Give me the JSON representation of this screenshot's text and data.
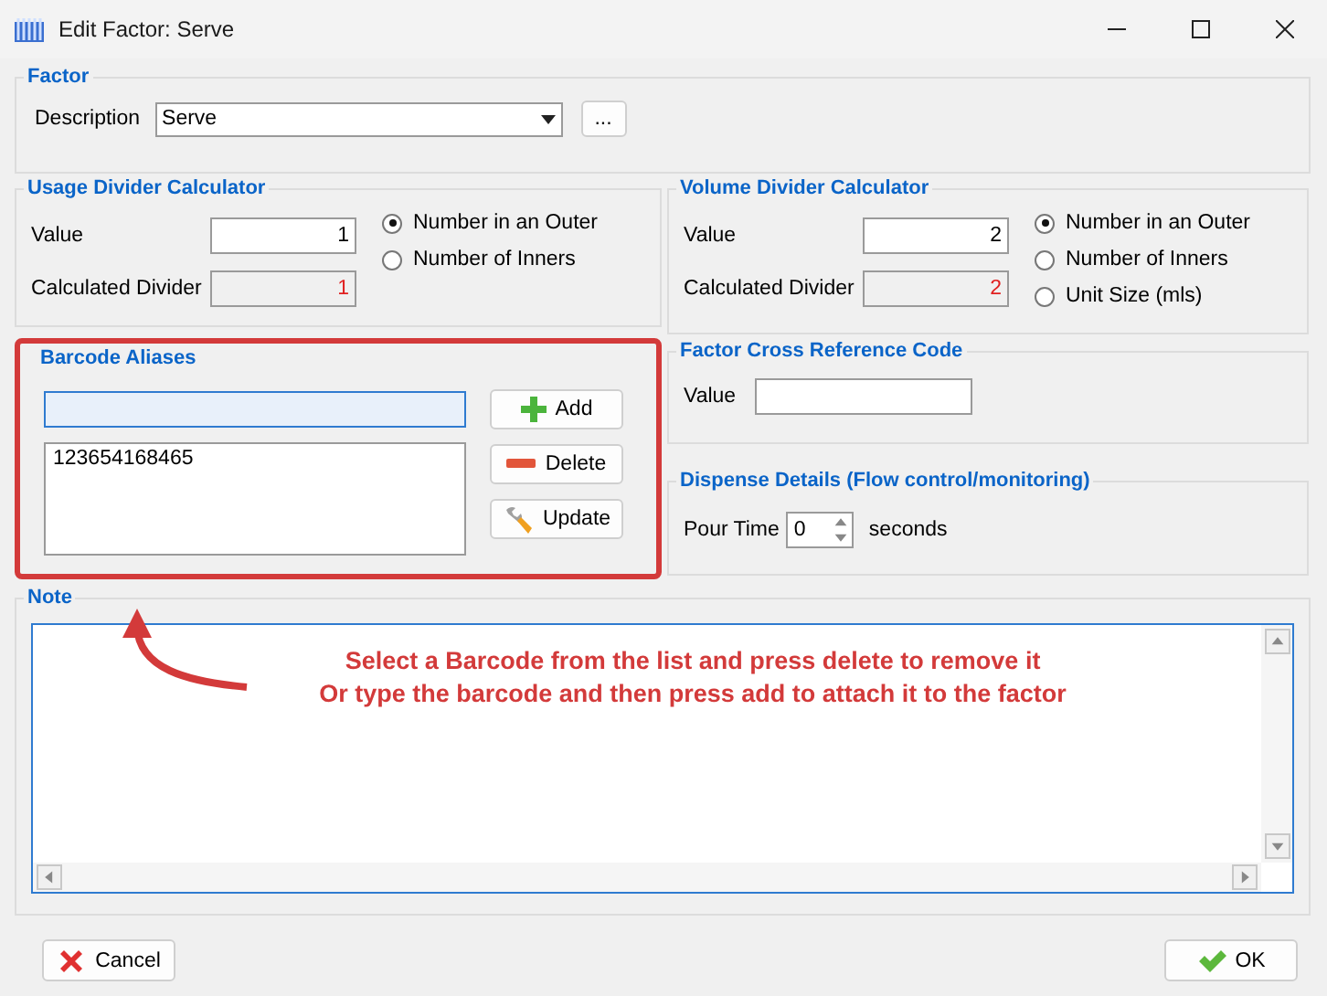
{
  "window": {
    "title": "Edit Factor: Serve"
  },
  "factor": {
    "title": "Factor",
    "description_label": "Description",
    "description_value": "Serve",
    "more_button": "..."
  },
  "usage": {
    "title": "Usage Divider Calculator",
    "value_label": "Value",
    "value": "1",
    "calc_label": "Calculated Divider",
    "calc_value": "1",
    "options": [
      {
        "label": "Number in an Outer",
        "selected": true
      },
      {
        "label": "Number of Inners",
        "selected": false
      }
    ]
  },
  "volume": {
    "title": "Volume Divider Calculator",
    "value_label": "Value",
    "value": "2",
    "calc_label": "Calculated Divider",
    "calc_value": "2",
    "options": [
      {
        "label": "Number in an Outer",
        "selected": true
      },
      {
        "label": "Number of Inners",
        "selected": false
      },
      {
        "label": "Unit Size (mls)",
        "selected": false
      }
    ]
  },
  "barcode": {
    "title": "Barcode Aliases",
    "highlighted": true,
    "aliases": [
      "123654168465"
    ],
    "buttons": [
      {
        "label": "Add",
        "kind": "add"
      },
      {
        "label": "Delete",
        "kind": "delete"
      },
      {
        "label": "Update",
        "kind": "update"
      }
    ]
  },
  "cross_ref": {
    "title": "Factor Cross Reference Code",
    "value_label": "Value"
  },
  "dispense": {
    "title": "Dispense Details (Flow control/monitoring)",
    "label": "Pour Time",
    "value": "0",
    "unit": "seconds"
  },
  "note": {
    "title": "Note"
  },
  "annotation": {
    "lines": [
      "Select a Barcode from the list and press delete to remove it",
      "Or type the barcode and then press add to attach it to the factor"
    ]
  },
  "footer_buttons": [
    {
      "label": "Cancel",
      "kind": "cancel"
    },
    {
      "label": "OK",
      "kind": "ok"
    }
  ]
}
